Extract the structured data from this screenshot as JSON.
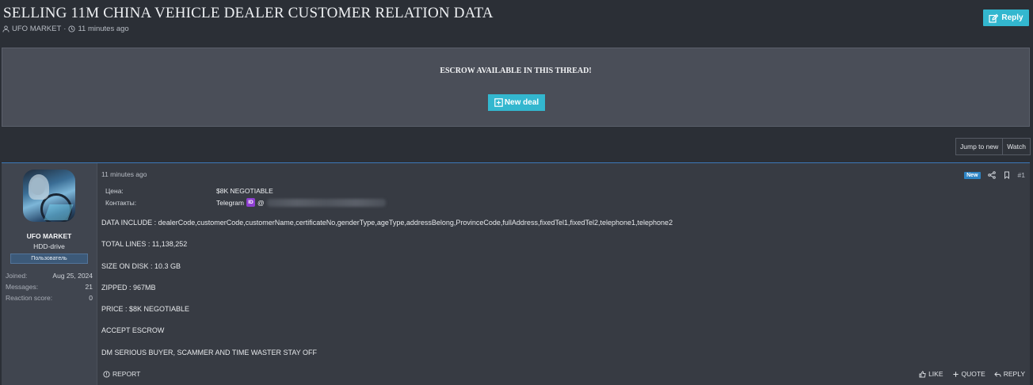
{
  "thread": {
    "title": "SELLING 11M CHINA VEHICLE DEALER CUSTOMER RELATION DATA",
    "author": "UFO MARKET",
    "separator": "·",
    "time": "11 minutes ago",
    "reply_label": "Reply"
  },
  "escrow": {
    "title": "ESCROW AVAILABLE IN THIS THREAD!",
    "button_label": "New deal"
  },
  "actions": {
    "jump_label": "Jump to new",
    "watch_label": "Watch"
  },
  "user": {
    "name": "UFO MARKET",
    "title": "HDD-drive",
    "badge": "Пользователь",
    "stats": [
      {
        "label": "Joined:",
        "value": "Aug 25, 2024"
      },
      {
        "label": "Messages:",
        "value": "21"
      },
      {
        "label": "Reaction score:",
        "value": "0"
      }
    ]
  },
  "post": {
    "date": "11 minutes ago",
    "new_badge": "New",
    "number": "#1",
    "fields": {
      "price_label": "Цена:",
      "price_value": "$8K NEGOTIABLE",
      "contacts_label": "Контакты:",
      "contacts_value": "Telegram",
      "tg_badge": "ID",
      "contacts_at": "@"
    },
    "lines": [
      "DATA INCLUDE : dealerCode,customerCode,customerName,certificateNo,genderType,ageType,addressBelong,ProvinceCode,fullAddress,fixedTel1,fixedTel2,telephone1,telephone2",
      "TOTAL LINES : 11,138,252",
      "SIZE ON DISK : 10.3 GB",
      "ZIPPED : 967MB",
      "PRICE : $8K NEGOTIABLE",
      "ACCEPT ESCROW",
      "DM SERIOUS BUYER, SCAMMER AND TIME WASTER STAY OFF"
    ],
    "footer": {
      "report": "REPORT",
      "like": "LIKE",
      "quote": "QUOTE",
      "reply": "REPLY"
    }
  },
  "colors": {
    "accent": "#33b7cf",
    "post_border": "#3d78b8",
    "badge_bg": "#3c5978",
    "tg_badge": "#8e3fd1"
  }
}
